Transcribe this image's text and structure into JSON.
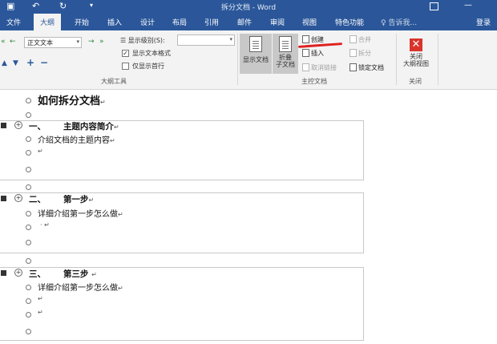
{
  "titlebar": {
    "undo_icon": "undo-icon",
    "redo_icon": "redo-icon",
    "title": "拆分文档 - Word",
    "minimize": "—",
    "close": "✕"
  },
  "tabs": {
    "items": [
      "文件",
      "大纲",
      "开始",
      "插入",
      "设计",
      "布局",
      "引用",
      "邮件",
      "审阅",
      "视图",
      "特色功能"
    ],
    "active": "大纲",
    "tell_me": "告诉我...",
    "login": "登录"
  },
  "outline_tools": {
    "level_value": "正文文本",
    "show_level_label": "显示级别(S):",
    "show_level_value": "",
    "show_formatting_label": "显示文本格式",
    "show_formatting_checked": true,
    "first_line_only_label": "仅显示首行",
    "first_line_only_checked": false,
    "group_label": "大纲工具"
  },
  "master_document": {
    "show_document": "显示文档",
    "collapse_sub": "折叠\n子文档",
    "create": "创建",
    "insert": "插入",
    "unlink": "取消链接",
    "merge": "合并",
    "split": "拆分",
    "lock": "锁定文档",
    "group_label": "主控文档"
  },
  "close_group": {
    "close_outline": "关闭\n大纲视图",
    "group_label": "关闭"
  },
  "document": {
    "title": "如何拆分文档",
    "sections": [
      {
        "heading_num": "一、",
        "heading": "主题内容简介",
        "body": "介绍文档的主题内容"
      },
      {
        "heading_num": "二、",
        "heading": "第一步",
        "body": "详细介绍第一步怎么做"
      },
      {
        "heading_num": "三、",
        "heading": "第三步",
        "body": "详细介绍第一步怎么做"
      }
    ],
    "para_mark": "↵"
  },
  "colors": {
    "ribbon_blue": "#2b579a",
    "ribbon_bg": "#f3f3f3",
    "annotation_red": "#e02020"
  }
}
